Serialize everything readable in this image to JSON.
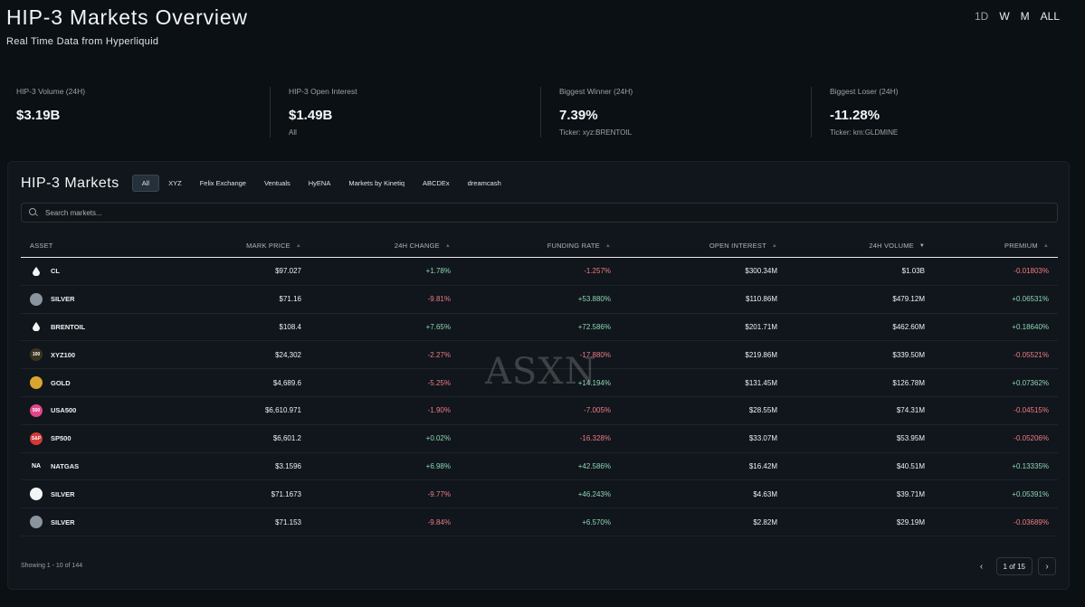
{
  "header": {
    "title": "HIP-3 Markets Overview",
    "subtitle": "Real Time Data from Hyperliquid",
    "ranges": [
      "1D",
      "W",
      "M",
      "ALL"
    ],
    "active_range": "1D"
  },
  "stats": [
    {
      "label": "HIP-3 Volume (24H)",
      "value": "$3.19B",
      "sub": ""
    },
    {
      "label": "HIP-3 Open Interest",
      "value": "$1.49B",
      "sub": "All"
    },
    {
      "label": "Biggest Winner (24H)",
      "value": "7.39%",
      "sub": "Ticker: xyz:BRENTOIL"
    },
    {
      "label": "Biggest Loser (24H)",
      "value": "-11.28%",
      "sub": "Ticker: km:GLDMINE"
    }
  ],
  "markets": {
    "title": "HIP-3 Markets",
    "filters": [
      "All",
      "XYZ",
      "Felix Exchange",
      "Ventuals",
      "HyENA",
      "Markets by Kinetiq",
      "ABCDEx",
      "dreamcash"
    ],
    "active_filter": "All",
    "search_placeholder": "Search markets...",
    "columns": [
      "ASSET",
      "MARK PRICE",
      "24H CHANGE",
      "FUNDING RATE",
      "OPEN INTEREST",
      "24H VOLUME",
      "PREMIUM"
    ],
    "rows": [
      {
        "asset": "CL",
        "icon": "oil-drop-icon",
        "icon_bg": "#10161b",
        "icon_text": "",
        "price": "$97.027",
        "change": "+1.78%",
        "funding": "-1.257%",
        "oi": "$300.34M",
        "volume": "$1.03B",
        "premium": "-0.01803%"
      },
      {
        "asset": "SILVER",
        "icon": "silver-coin-icon",
        "icon_bg": "#8a949c",
        "icon_text": "",
        "price": "$71.16",
        "change": "-9.81%",
        "funding": "+53.880%",
        "oi": "$110.86M",
        "volume": "$479.12M",
        "premium": "+0.06531%"
      },
      {
        "asset": "BRENTOIL",
        "icon": "oil-drop-icon",
        "icon_bg": "#10161b",
        "icon_text": "",
        "price": "$108.4",
        "change": "+7.65%",
        "funding": "+72.586%",
        "oi": "$201.71M",
        "volume": "$462.60M",
        "premium": "+0.18640%"
      },
      {
        "asset": "XYZ100",
        "icon": "xyz100-icon",
        "icon_bg": "#3a3320",
        "icon_text": "100",
        "price": "$24,302",
        "change": "-2.27%",
        "funding": "-17.880%",
        "oi": "$219.86M",
        "volume": "$339.50M",
        "premium": "-0.05521%"
      },
      {
        "asset": "GOLD",
        "icon": "gold-coin-icon",
        "icon_bg": "#d9a531",
        "icon_text": "",
        "price": "$4,689.6",
        "change": "-5.25%",
        "funding": "+14.194%",
        "oi": "$131.45M",
        "volume": "$126.78M",
        "premium": "+0.07362%"
      },
      {
        "asset": "USA500",
        "icon": "usa500-icon",
        "icon_bg": "#e1458a",
        "icon_text": "500",
        "price": "$6,610.971",
        "change": "-1.90%",
        "funding": "-7.005%",
        "oi": "$28.55M",
        "volume": "$74.31M",
        "premium": "-0.04515%"
      },
      {
        "asset": "SP500",
        "icon": "sp500-icon",
        "icon_bg": "#d23a3a",
        "icon_text": "S&P",
        "price": "$6,601.2",
        "change": "+0.02%",
        "funding": "-16.328%",
        "oi": "$33.07M",
        "volume": "$53.95M",
        "premium": "-0.05206%"
      },
      {
        "asset": "NATGAS",
        "icon": "natgas-icon",
        "icon_bg": "#10161b",
        "icon_text": "NA",
        "price": "$3.1596",
        "change": "+6.98%",
        "funding": "+42.586%",
        "oi": "$16.42M",
        "volume": "$40.51M",
        "premium": "+0.13335%"
      },
      {
        "asset": "SILVER",
        "icon": "silver-coin-icon",
        "icon_bg": "#f2f4f5",
        "icon_text": "",
        "price": "$71.1673",
        "change": "-9.77%",
        "funding": "+46.243%",
        "oi": "$4.63M",
        "volume": "$39.71M",
        "premium": "+0.05391%"
      },
      {
        "asset": "SILVER",
        "icon": "silver-coin-icon",
        "icon_bg": "#8a949c",
        "icon_text": "",
        "price": "$71.153",
        "change": "-9.84%",
        "funding": "+6.570%",
        "oi": "$2.82M",
        "volume": "$29.19M",
        "premium": "-0.03689%"
      }
    ],
    "showing": "Showing 1 - 10 of 144",
    "page_label": "1 of 15"
  },
  "watermark": "ASXN",
  "colors": {
    "positive": "#8fd6b6",
    "negative": "#f07b86",
    "background": "#0b1014"
  }
}
